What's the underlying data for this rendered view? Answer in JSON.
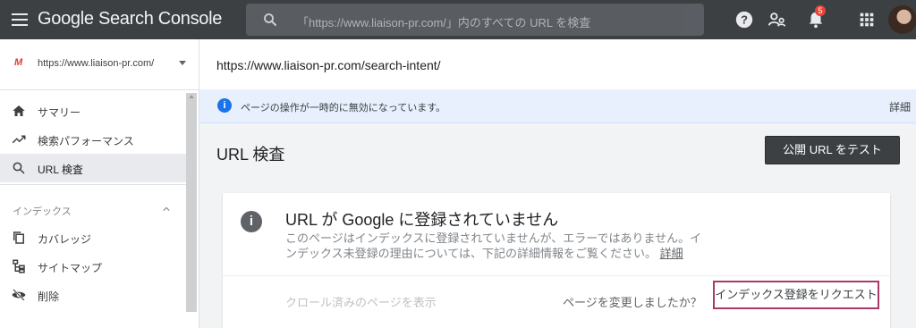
{
  "app": {
    "title": "Google Search Console",
    "search_placeholder": "「https://www.liaison-pr.com/」内のすべての URL を検査",
    "notification_count": "5"
  },
  "sidebar": {
    "property": "https://www.liaison-pr.com/",
    "items": [
      {
        "label": "サマリー",
        "icon": "home-icon"
      },
      {
        "label": "検索パフォーマンス",
        "icon": "trending-up-icon"
      },
      {
        "label": "URL 検査",
        "icon": "search-icon",
        "active": true
      }
    ],
    "section": {
      "title": "インデックス",
      "items": [
        {
          "label": "カバレッジ",
          "icon": "copy-icon"
        },
        {
          "label": "サイトマップ",
          "icon": "sitemap-icon"
        },
        {
          "label": "削除",
          "icon": "visibility-off-icon"
        }
      ]
    }
  },
  "main": {
    "url": "https://www.liaison-pr.com/search-intent/",
    "banner": {
      "text": "ページの操作が一時的に無効になっています。",
      "link": "詳細"
    },
    "title": "URL 検査",
    "test_button": "公開 URL をテスト",
    "card": {
      "title": "URL が Google に登録されていません",
      "desc": "このページはインデックスに登録されていませんが、エラーではありません。インデックス未登録の理由については、下記の詳細情報をご覧ください。",
      "desc_link": "詳細",
      "crawl_link": "クロール済みのページを表示",
      "changed_text": "ページを変更しましたか？",
      "request_button": "インデックス登録をリクエスト"
    }
  },
  "colors": {
    "topbar": "#3c4043",
    "accent_blue": "#1a73e8",
    "request_border": "#a93a6a",
    "notification_red": "#ea4335"
  }
}
